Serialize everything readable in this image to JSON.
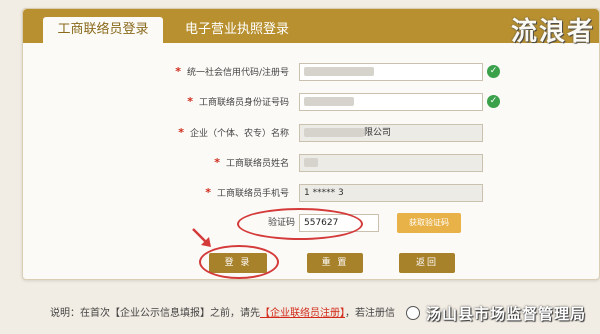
{
  "tabs": [
    {
      "label": "工商联络员登录",
      "active": true
    },
    {
      "label": "电子营业执照登录",
      "active": false
    }
  ],
  "watermark_top": "流浪者",
  "form": {
    "fields": [
      {
        "label": "统一社会信用代码/注册号",
        "value": "",
        "required": true,
        "verified": true
      },
      {
        "label": "工商联络员身份证号码",
        "value": "",
        "required": true,
        "verified": true
      },
      {
        "label": "企业（个体、农专）名称",
        "value": "限公司",
        "required": true,
        "verified": false
      },
      {
        "label": "工商联络员姓名",
        "value": "",
        "required": true,
        "verified": false
      },
      {
        "label": "工商联络员手机号",
        "value": "1 ***** 3",
        "required": true,
        "verified": false
      }
    ],
    "captcha": {
      "label": "验证码",
      "value": "557627",
      "button": "获取验证码"
    },
    "buttons": {
      "login": "登 录",
      "reset": "重 置",
      "back": "返回"
    }
  },
  "notice": {
    "prefix": "说明：在首次【企业公示信息填报】之前，请先",
    "link": "【企业联络员注册】",
    "suffix": "，若注册信"
  },
  "watermark_bottom": "汤山县市场监督管理局",
  "colors": {
    "accent": "#b8902f",
    "button": "#a8812b",
    "highlight": "#d43a3a",
    "check": "#3aa14a"
  },
  "icons": [
    "check-icon",
    "arrow-icon",
    "wechat-icon"
  ]
}
